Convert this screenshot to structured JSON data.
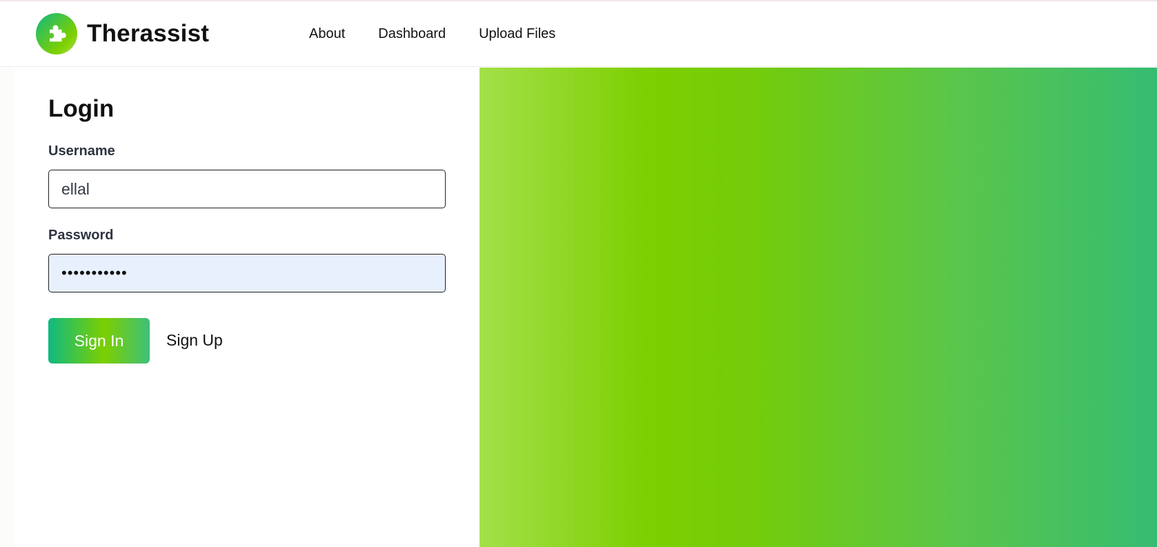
{
  "app": {
    "brand": "Therassist"
  },
  "nav": {
    "links": [
      "About",
      "Dashboard",
      "Upload Files"
    ]
  },
  "login": {
    "title": "Login",
    "username_label": "Username",
    "username_value": "ellal",
    "password_label": "Password",
    "password_mask": "•••••••••••",
    "signin_label": "Sign In",
    "signup_label": "Sign Up"
  },
  "colors": {
    "brand_green": "#7ccf00",
    "brand_teal": "#10b981",
    "autofill_bg": "#e8f0fe"
  },
  "icons": {
    "logo": "puzzle-piece-icon"
  }
}
